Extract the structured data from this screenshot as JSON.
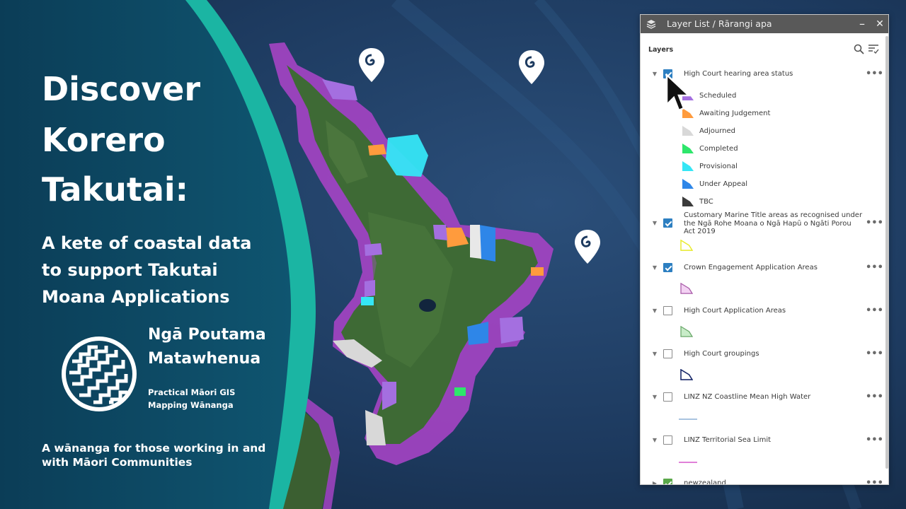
{
  "title": {
    "line1": "Discover",
    "line2": "Korero",
    "line3": "Takutai:"
  },
  "subtitle": {
    "line1": "A kete of coastal data",
    "line2": "to  support Takutai",
    "line3": "Moana Applications"
  },
  "org": {
    "name_line1": "Ngā Poutama",
    "name_line2": "Matawhenua",
    "tag_line1": "Practical Māori GIS",
    "tag_line2": "Mapping Wānanga",
    "logo_icon": "poutama-logo-icon"
  },
  "footer": {
    "line1": "A wānanga for those working in and",
    "line2": "with Māori Communities"
  },
  "widget": {
    "title": "Layer List / Rārangi apa",
    "minimize": "–",
    "close": "✕",
    "layers_label": "Layers",
    "layers": [
      {
        "title": "High Court hearing area status",
        "checked": true,
        "legend": [
          {
            "label": "Scheduled",
            "color": "#a46fe0"
          },
          {
            "label": "Awaiting Judgement",
            "color": "#ff9b3d"
          },
          {
            "label": "Adjourned",
            "color": "#d8d8d8"
          },
          {
            "label": "Completed",
            "color": "#2ee66b"
          },
          {
            "label": "Provisional",
            "color": "#35e6f5"
          },
          {
            "label": "Under Appeal",
            "color": "#2e86e8"
          },
          {
            "label": "TBC",
            "color": "#3b3b3b"
          }
        ]
      },
      {
        "title_line1": "Customary Marine Title areas as recognised under",
        "title_line2": "the Ngā Rohe Moana o Ngā Hapū o Ngāti Porou",
        "title_line3": "Act 2019",
        "checked": true,
        "symbol_fill": "#ffffff",
        "symbol_stroke": "#e8ea2a"
      },
      {
        "title": "Crown Engagement Application Areas",
        "checked": true,
        "symbol_fill": "#f3d2f3",
        "symbol_stroke": "#a85aa8"
      },
      {
        "title": "High Court Application Areas",
        "checked": false,
        "symbol_fill": "#c8ecc8",
        "symbol_stroke": "#6aa86a"
      },
      {
        "title": "High Court groupings",
        "checked": false,
        "symbol_fill": "#ffffff",
        "symbol_stroke": "#1a2a6b"
      },
      {
        "title": "LINZ NZ Coastline Mean High Water",
        "checked": false,
        "line_color": "#a9c4e0"
      },
      {
        "title": "LINZ Territorial Sea Limit",
        "checked": false,
        "line_color": "#e080d8"
      },
      {
        "title": "newzealand",
        "checked": true
      }
    ]
  },
  "colors": {
    "panel_dark": "#0d4560",
    "teal_accent": "#18b6a4",
    "cmt_purple": "#b04fc8",
    "land_green": "#3f6b34",
    "sea_blue": "#1f3d63"
  }
}
